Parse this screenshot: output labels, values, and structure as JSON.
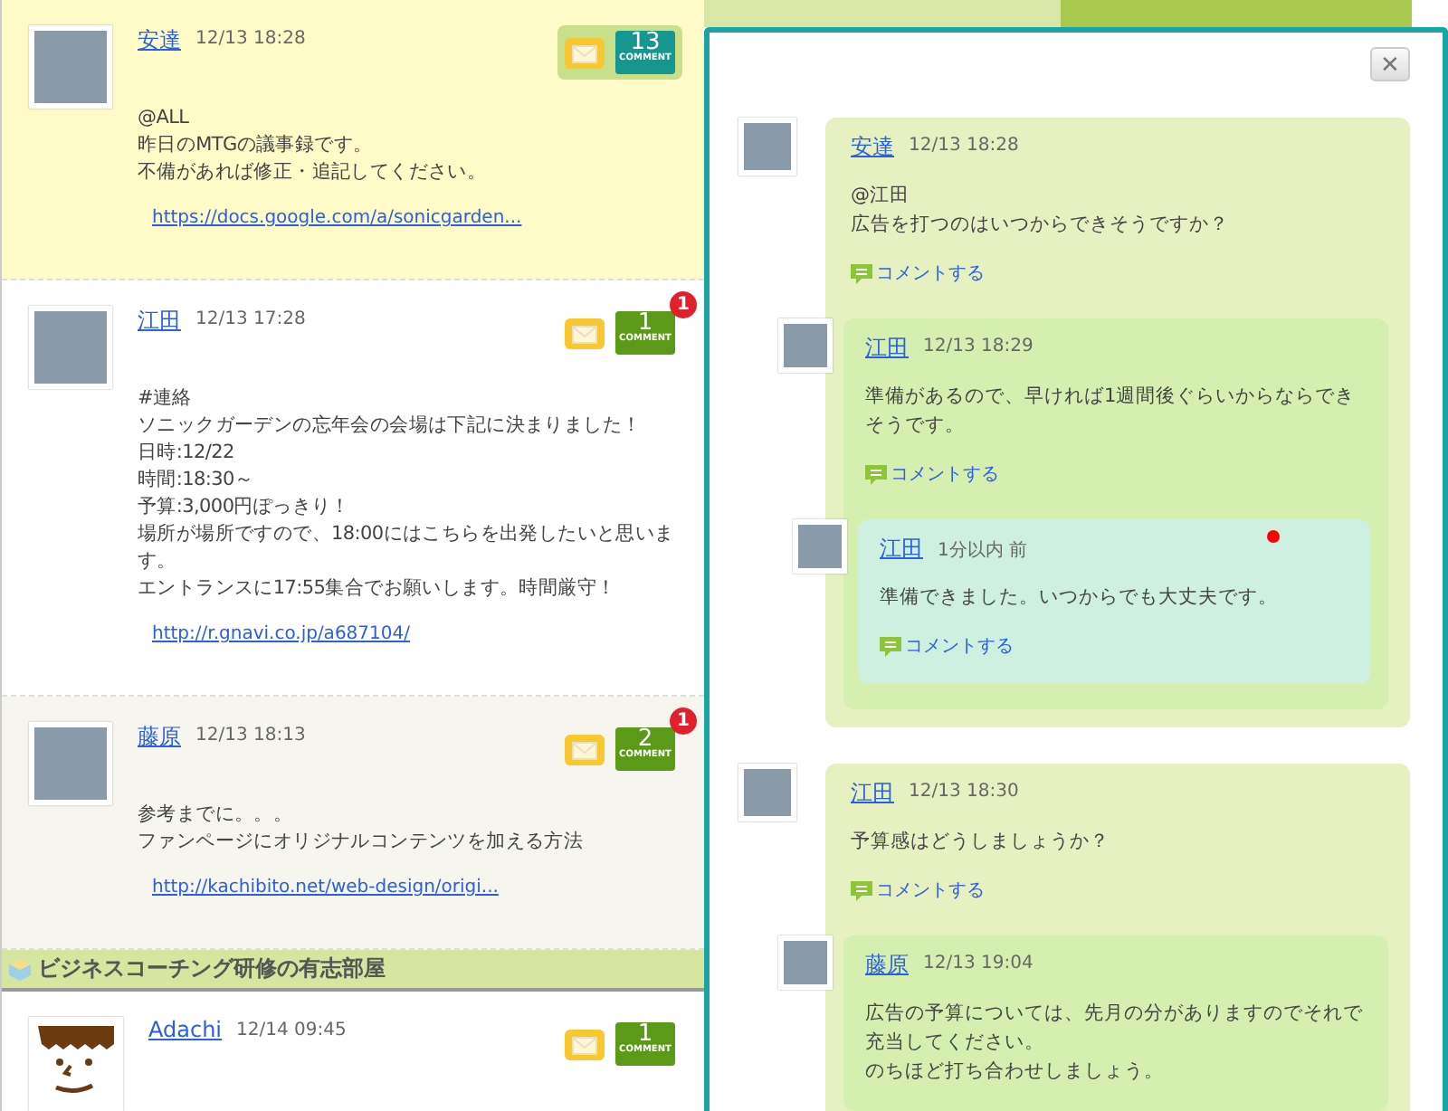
{
  "posts": [
    {
      "author": "安達",
      "time": "12/13 18:28",
      "kind": "photo",
      "selected": true,
      "shaded": false,
      "comment_count": "13",
      "comment_label": "COMMENT",
      "body": [
        "@ALL",
        "昨日のMTGの議事録です。",
        "不備があれば修正・追記してください。"
      ],
      "link": "https://docs.google.com/a/sonicgarden..."
    },
    {
      "author": "江田",
      "time": "12/13 17:28",
      "kind": "photo",
      "selected": false,
      "shaded": false,
      "comment_count": "1",
      "comment_label": "COMMENT",
      "new_count": "1",
      "body": [
        "#連絡",
        "ソニックガーデンの忘年会の会場は下記に決まりました！",
        "日時:12/22",
        "時間:18:30～",
        "予算:3,000円ぽっきり！",
        "場所が場所ですので、18:00にはこちらを出発したいと思います。",
        "エントランスに17:55集合でお願いします。時間厳守！"
      ],
      "link": "http://r.gnavi.co.jp/a687104/"
    },
    {
      "author": "藤原",
      "time": "12/13 18:13",
      "kind": "photo",
      "selected": false,
      "shaded": true,
      "comment_count": "2",
      "comment_label": "COMMENT",
      "new_count": "1",
      "body": [
        "参考までに。。。",
        "ファンページにオリジナルコンテンツを加える方法"
      ],
      "link": "http://kachibito.net/web-design/origi..."
    }
  ],
  "section": {
    "title": "ビジネスコーチング研修の有志部屋"
  },
  "section_posts": [
    {
      "author": "Adachi",
      "time": "12/14 09:45",
      "kind": "drawing",
      "selected": false,
      "shaded": false,
      "comment_count": "1",
      "comment_label": "COMMENT"
    }
  ],
  "thread_panel": {
    "close_label": "✕",
    "threads": [
      {
        "author": "安達",
        "time": "12/13 18:28",
        "unread": false,
        "body": [
          "@江田",
          "広告を打つのはいつからできそうですか？"
        ],
        "reply": "コメントする",
        "children": [
          {
            "author": "江田",
            "time": "12/13 18:29",
            "unread": false,
            "body": [
              "準備があるので、早ければ1週間後ぐらいからならできそうです。"
            ],
            "reply": "コメントする",
            "children": [
              {
                "author": "江田",
                "time": "1分以内 前",
                "unread": true,
                "body": [
                  "準備できました。いつからでも大丈夫です。"
                ],
                "reply": "コメントする"
              }
            ]
          }
        ]
      },
      {
        "author": "江田",
        "time": "12/13 18:30",
        "unread": false,
        "body": [
          "予算感はどうしましょうか？"
        ],
        "reply": "コメントする",
        "children": [
          {
            "author": "藤原",
            "time": "12/13 19:04",
            "unread": false,
            "body": [
              "広告の予算については、先月の分がありますのでそれで充当してください。",
              "のちほど打ち合わせしましょう。"
            ]
          }
        ]
      }
    ]
  }
}
